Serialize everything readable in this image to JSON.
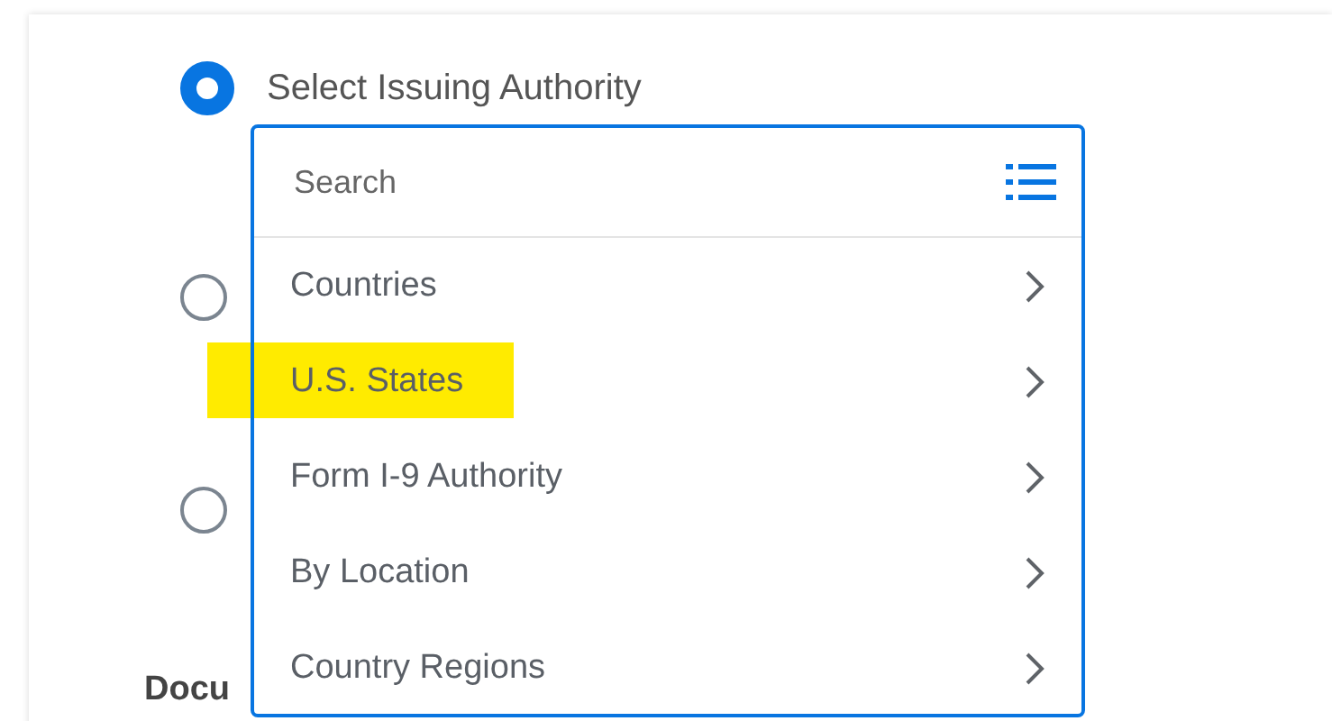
{
  "options": [
    {
      "label": "Select Issuing Authority",
      "selected": true
    },
    {
      "selected": false
    },
    {
      "selected": false
    }
  ],
  "dropdown": {
    "search": {
      "placeholder": "Search"
    },
    "items": [
      {
        "label": "Countries",
        "highlighted": false
      },
      {
        "label": "U.S. States",
        "highlighted": true
      },
      {
        "label": "Form I-9 Authority",
        "highlighted": false
      },
      {
        "label": "By Location",
        "highlighted": false
      },
      {
        "label": "Country Regions",
        "highlighted": false
      }
    ]
  },
  "section_heading": "Docu"
}
